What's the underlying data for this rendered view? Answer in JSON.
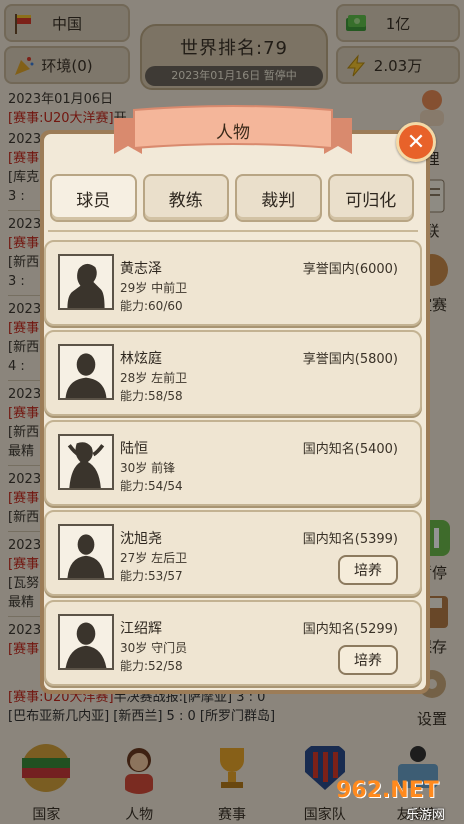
{
  "top": {
    "country": "中国",
    "money": "1亿",
    "environment": "环境(0)",
    "cash": "2.03万",
    "rank_label": "世界排名:79",
    "date_status": "2023年01月16日 暂停中"
  },
  "news": {
    "line1_date": "2023年01月06日",
    "line1_tag": "[赛事:U20大洋赛]",
    "line1_text": "开",
    "bottom_tag": "[赛事:U20大洋赛]",
    "bottom_text": "半决赛战报:[萨摩亚] 3 : 0",
    "bottom_line2": "[巴布亚新几内亚] [新西兰] 5 : 0 [所罗门群岛]"
  },
  "fragments": [
    "2023",
    "[赛事",
    "[库克",
    "3 :",
    "2023",
    "[赛事",
    "[新西",
    "3 :",
    "2023",
    "[赛事",
    "[新西",
    "4 :",
    "2023",
    "[赛事",
    "[新西",
    "最精",
    "2023",
    "[赛事",
    "[新西",
    "2023",
    "[赛事",
    "[瓦努",
    "最精",
    "2023",
    "[赛事"
  ],
  "side": {
    "manage": "理",
    "league": "联",
    "friendly": "谊赛",
    "pause": "暂停",
    "save": "保存",
    "settings": "设置"
  },
  "nav": {
    "country": "国家",
    "people": "人物",
    "events": "赛事",
    "national_team": "国家队",
    "friendly": "友谊赛"
  },
  "modal": {
    "title": "人物",
    "tabs": [
      "球员",
      "教练",
      "裁判",
      "可归化"
    ],
    "train_label": "培养",
    "players": [
      {
        "name": "黄志泽",
        "info": "29岁  中前卫",
        "ability": "能力:60/60",
        "fame": "享誉国内(6000)",
        "trainable": false
      },
      {
        "name": "林炫庭",
        "info": "28岁  左前卫",
        "ability": "能力:58/58",
        "fame": "享誉国内(5800)",
        "trainable": false
      },
      {
        "name": "陆恒",
        "info": "30岁  前锋",
        "ability": "能力:54/54",
        "fame": "国内知名(5400)",
        "trainable": false
      },
      {
        "name": "沈旭尧",
        "info": "27岁  左后卫",
        "ability": "能力:53/57",
        "fame": "国内知名(5399)",
        "trainable": true
      },
      {
        "name": "江绍辉",
        "info": "30岁  守门员",
        "ability": "能力:52/58",
        "fame": "国内知名(5299)",
        "trainable": true
      }
    ]
  },
  "watermark": {
    "brand": "962.NET",
    "sub": "乐游网"
  },
  "colors": {
    "accent": "#e8622a",
    "news_red": "#c4281d",
    "panel": "#f2e9d8",
    "frame": "#9c7c57"
  }
}
